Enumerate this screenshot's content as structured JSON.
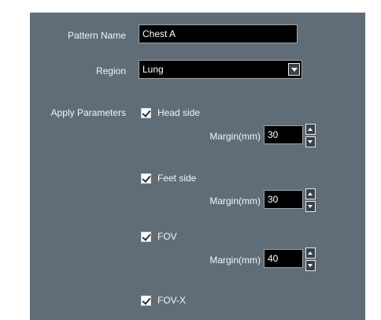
{
  "pattern_name": {
    "label": "Pattern Name",
    "value": "Chest A"
  },
  "region": {
    "label": "Region",
    "value": "Lung"
  },
  "apply_parameters": {
    "label": "Apply Parameters",
    "items": [
      {
        "label": "Head side",
        "checked": true,
        "margin_label": "Margin(mm)",
        "margin_value": "30"
      },
      {
        "label": "Feet side",
        "checked": true,
        "margin_label": "Margin(mm)",
        "margin_value": "30"
      },
      {
        "label": "FOV",
        "checked": true,
        "margin_label": "Margin(mm)",
        "margin_value": "40"
      },
      {
        "label": "FOV-X",
        "checked": true
      }
    ]
  },
  "colors": {
    "panel_bg": "#606d76",
    "field_bg": "#000000",
    "text": "#f2f5f7"
  }
}
